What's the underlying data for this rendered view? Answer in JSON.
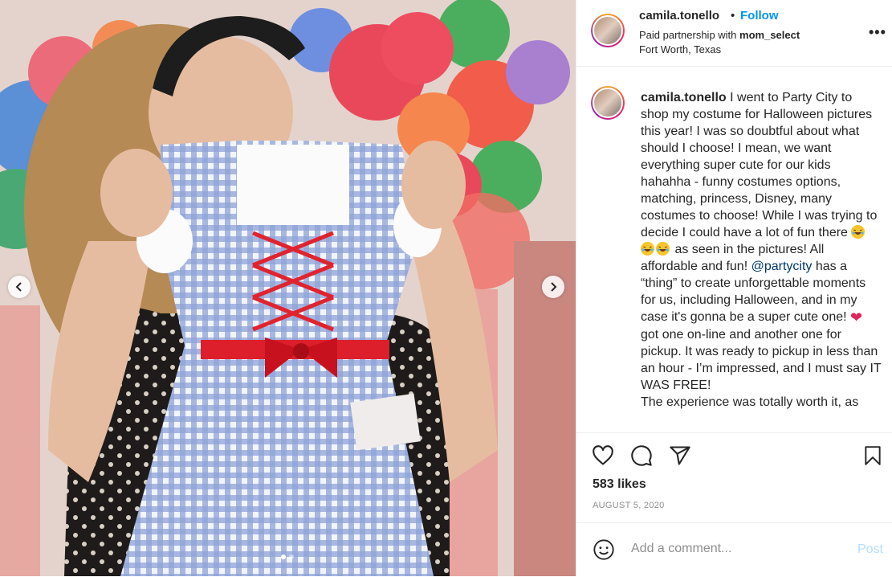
{
  "post": {
    "username": "camila.tonello",
    "bullet": "•",
    "follow_label": "Follow",
    "paid_prefix": "Paid partnership with",
    "partner": "mom_select",
    "location": "Fort Worth, Texas",
    "more_label": "•••"
  },
  "caption": {
    "username": "camila.tonello",
    "text_1": "I went to Party City to shop my costume for Halloween pictures this year! I was so doubtful about what should I choose! I mean, we want everything super cute for our kids hahahha - funny costumes options, matching, princess, Disney, many costumes to choose! While I was trying to decide I could have a lot of fun there",
    "text_2": "as seen in the pictures! All affordable and fun!",
    "mention": "@partycity",
    "text_3": "has a “thing” to create unforgettable moments for us, including Halloween, and in my case it's gonna be a super cute one!",
    "heart": "❤",
    "text_4": "got one on-line and another one for pickup. It was ready to pickup in less than an hour - I’m impressed, and I must say IT WAS FREE!",
    "text_5": "The experience was totally worth it, as",
    "emojis": [
      "face-with-tears-of-joy",
      "face-with-tears-of-joy",
      "face-with-tears-of-joy"
    ]
  },
  "actions": {
    "likes": "583 likes",
    "date": "AUGUST 5, 2020"
  },
  "comment": {
    "placeholder": "Add a comment...",
    "post_label": "Post"
  },
  "carousel": {
    "slide_count": 2,
    "active_index": 0
  },
  "colors": {
    "follow": "#0095f6",
    "mention": "#00376b",
    "post_disabled": "#b2dffc",
    "muted": "#8e8e8e"
  }
}
